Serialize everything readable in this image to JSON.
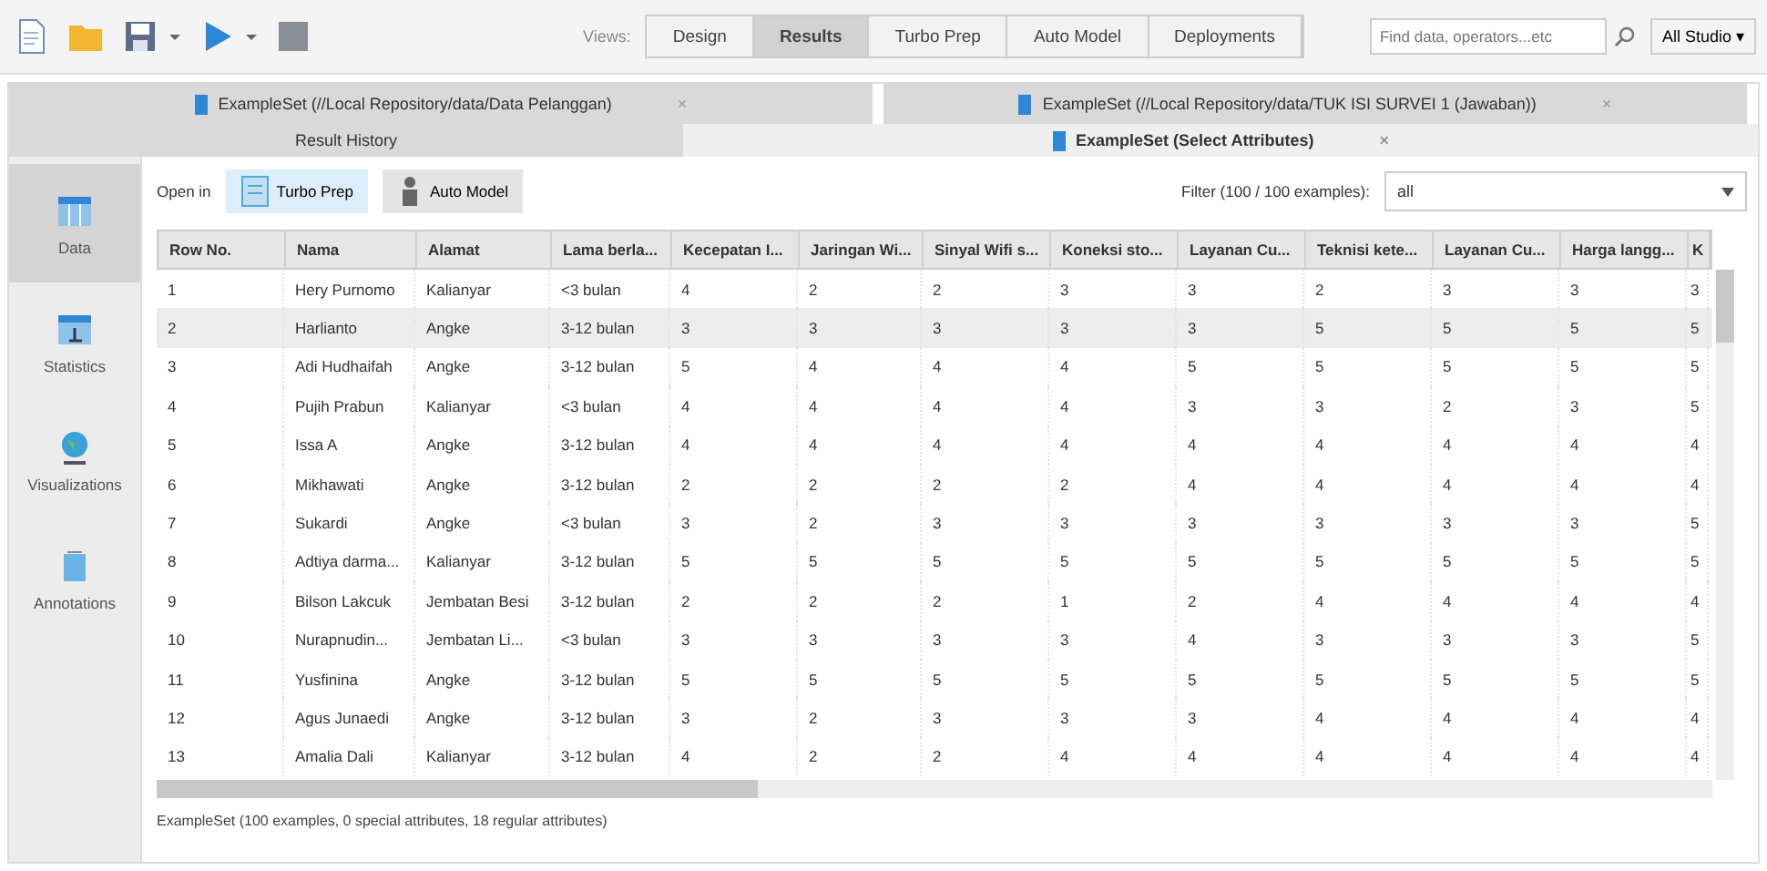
{
  "toolbar": {
    "views_label": "Views:",
    "perspectives": [
      {
        "label": "Design",
        "selected": false
      },
      {
        "label": "Results",
        "selected": true
      },
      {
        "label": "Turbo Prep",
        "selected": false
      },
      {
        "label": "Auto Model",
        "selected": false
      },
      {
        "label": "Deployments",
        "selected": false
      }
    ],
    "search": {
      "placeholder": "Find data, operators...etc"
    },
    "studio_menu": "All Studio ▾"
  },
  "result_tabs": [
    {
      "label": "ExampleSet (//Local Repository/data/Data Pelanggan)",
      "close": "×",
      "selected": false
    },
    {
      "label": "ExampleSet (//Local Repository/data/TUK ISI SURVEI 1 (Jawaban))",
      "close": "×",
      "selected": false
    }
  ],
  "sub_tabs": [
    {
      "label": "Result History",
      "selected": false
    },
    {
      "label": "ExampleSet (Select Attributes)",
      "close": "×",
      "selected": true
    }
  ],
  "sidebar": {
    "items": [
      {
        "label": "Data",
        "kind": "data",
        "selected": true
      },
      {
        "label": "Statistics",
        "kind": "statistics",
        "selected": false
      },
      {
        "label": "Visualizations",
        "kind": "visualizations",
        "selected": false
      },
      {
        "label": "Annotations",
        "kind": "annotations",
        "selected": false
      }
    ]
  },
  "open_in": {
    "label": "Open in",
    "buttons": [
      {
        "label": "Turbo Prep",
        "kind": "turbo"
      },
      {
        "label": "Auto Model",
        "kind": "auto"
      }
    ]
  },
  "filter": {
    "label": "Filter (100 / 100 examples):",
    "value": "all"
  },
  "table": {
    "columns": [
      "Row No.",
      "Nama",
      "Alamat",
      "Lama berla...",
      "Kecepatan I...",
      "Jaringan Wi...",
      "Sinyal Wifi s...",
      "Koneksi sto...",
      "Layanan Cu...",
      "Teknisi kete...",
      "Layanan Cu...",
      "Harga langg...",
      "K"
    ],
    "rows": [
      {
        "selected": false,
        "cells": [
          "1",
          "Hery Purnomo",
          "Kalianyar",
          "<3 bulan",
          "4",
          "2",
          "2",
          "3",
          "3",
          "2",
          "3",
          "3",
          "3"
        ]
      },
      {
        "selected": true,
        "cells": [
          "2",
          "Harlianto",
          "Angke",
          "3-12 bulan",
          "3",
          "3",
          "3",
          "3",
          "3",
          "5",
          "5",
          "5",
          "5"
        ]
      },
      {
        "selected": false,
        "cells": [
          "3",
          "Adi Hudhaifah",
          "Angke",
          "3-12 bulan",
          "5",
          "4",
          "4",
          "4",
          "5",
          "5",
          "5",
          "5",
          "5"
        ]
      },
      {
        "selected": false,
        "cells": [
          "4",
          "Pujih Prabun",
          "Kalianyar",
          "<3 bulan",
          "4",
          "4",
          "4",
          "4",
          "3",
          "3",
          "2",
          "3",
          "5"
        ]
      },
      {
        "selected": false,
        "cells": [
          "5",
          "Issa A",
          "Angke",
          "3-12 bulan",
          "4",
          "4",
          "4",
          "4",
          "4",
          "4",
          "4",
          "4",
          "4"
        ]
      },
      {
        "selected": false,
        "cells": [
          "6",
          "Mikhawati",
          "Angke",
          "3-12 bulan",
          "2",
          "2",
          "2",
          "2",
          "4",
          "4",
          "4",
          "4",
          "4"
        ]
      },
      {
        "selected": false,
        "cells": [
          "7",
          "Sukardi",
          "Angke",
          "<3 bulan",
          "3",
          "2",
          "3",
          "3",
          "3",
          "3",
          "3",
          "3",
          "5"
        ]
      },
      {
        "selected": false,
        "cells": [
          "8",
          "Adtiya darma...",
          "Kalianyar",
          "3-12 bulan",
          "5",
          "5",
          "5",
          "5",
          "5",
          "5",
          "5",
          "5",
          "5"
        ]
      },
      {
        "selected": false,
        "cells": [
          "9",
          "Bilson Lakcuk",
          "Jembatan Besi",
          "3-12 bulan",
          "2",
          "2",
          "2",
          "1",
          "2",
          "4",
          "4",
          "4",
          "4"
        ]
      },
      {
        "selected": false,
        "cells": [
          "10",
          "Nurapnudin...",
          "Jembatan Li...",
          "<3 bulan",
          "3",
          "3",
          "3",
          "3",
          "4",
          "3",
          "3",
          "3",
          "5"
        ]
      },
      {
        "selected": false,
        "cells": [
          "11",
          "Yusfinina",
          "Angke",
          "3-12 bulan",
          "5",
          "5",
          "5",
          "5",
          "5",
          "5",
          "5",
          "5",
          "5"
        ]
      },
      {
        "selected": false,
        "cells": [
          "12",
          "Agus Junaedi",
          "Angke",
          "3-12 bulan",
          "3",
          "2",
          "3",
          "3",
          "3",
          "4",
          "4",
          "4",
          "4"
        ]
      },
      {
        "selected": false,
        "cells": [
          "13",
          "Amalia Dali",
          "Kalianyar",
          "3-12 bulan",
          "4",
          "2",
          "2",
          "4",
          "4",
          "4",
          "4",
          "4",
          "4"
        ]
      }
    ]
  },
  "status_bar": "ExampleSet (100 examples, 0 special attributes, 18 regular attributes)"
}
